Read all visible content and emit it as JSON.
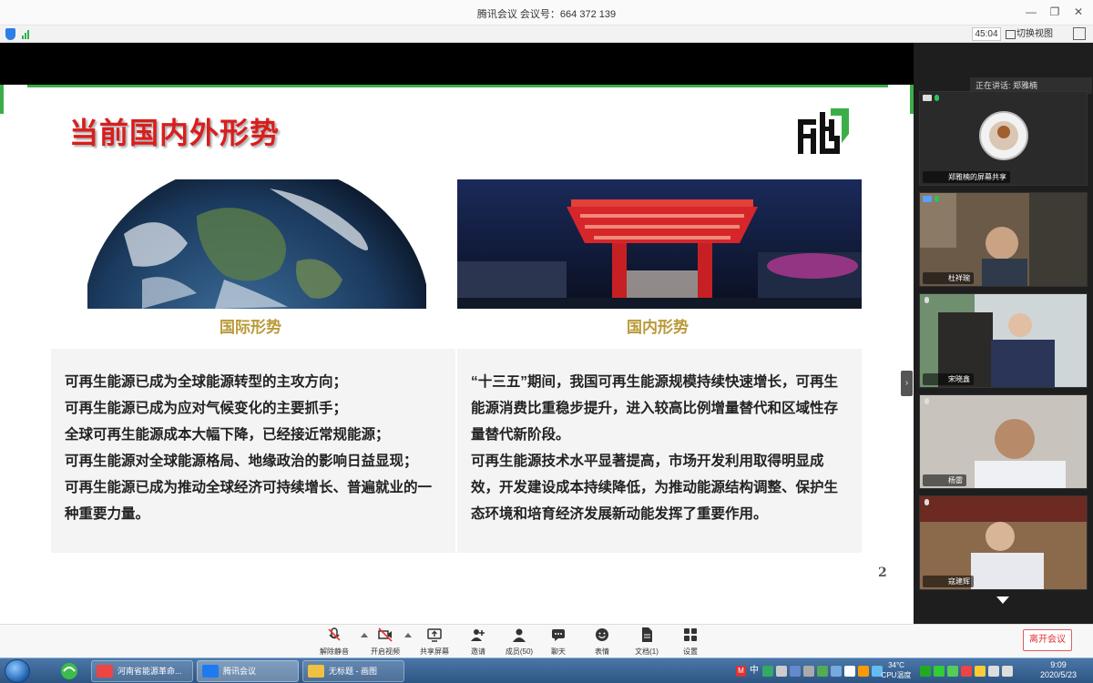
{
  "window": {
    "title": "腾讯会议 会议号：664 372 139",
    "timer": "45:04",
    "switch_view": "切换视图"
  },
  "slide": {
    "title": "当前国内外形势",
    "left_caption": "国际形势",
    "right_caption": "国内形势",
    "left_text": "可再生能源已成为全球能源转型的主攻方向；\n可再生能源已成为应对气候变化的主要抓手；\n全球可再生能源成本大幅下降，已经接近常规能源；\n可再生能源对全球能源格局、地缘政治的影响日益显现；\n可再生能源已成为推动全球经济可持续增长、普遍就业的一种重要力量。",
    "right_text": "“十三五”期间，我国可再生能源规模持续快速增长，可再生能源消费比重稳步提升，进入较高比例增量替代和区域性存量替代新阶段。\n可再生能源技术水平显著提高，市场开发利用取得明显成效，开发建设成本持续降低，为推动能源结构调整、保护生态环境和培育经济发展新动能发挥了重要作用。",
    "page_number": "2",
    "accent_green": "#3cae49",
    "title_red": "#d81e1e"
  },
  "sidebar": {
    "speaking_label": "正在讲话: 郑雅楠",
    "participants": [
      {
        "name": "郑雅楠的屏幕共享"
      },
      {
        "name": "杜祥琬"
      },
      {
        "name": "宋晓鑫"
      },
      {
        "name": "杨雷"
      },
      {
        "name": "寇建辉"
      }
    ]
  },
  "toolbar": {
    "mute": "解除静音",
    "video": "开启视频",
    "share": "共享屏幕",
    "invite": "邀请",
    "members": "成员(50)",
    "chat": "聊天",
    "reactions": "表情",
    "docs": "文档(1)",
    "settings": "设置",
    "leave": "离开会议"
  },
  "taskbar": {
    "tasks": [
      {
        "label": "河南省能源革命..."
      },
      {
        "label": "腾讯会议"
      },
      {
        "label": "无标题 - 画图"
      }
    ],
    "ime": "中",
    "temp": "34°C",
    "temp_label": "CPU温度",
    "time": "9:09",
    "date": "2020/5/23"
  }
}
